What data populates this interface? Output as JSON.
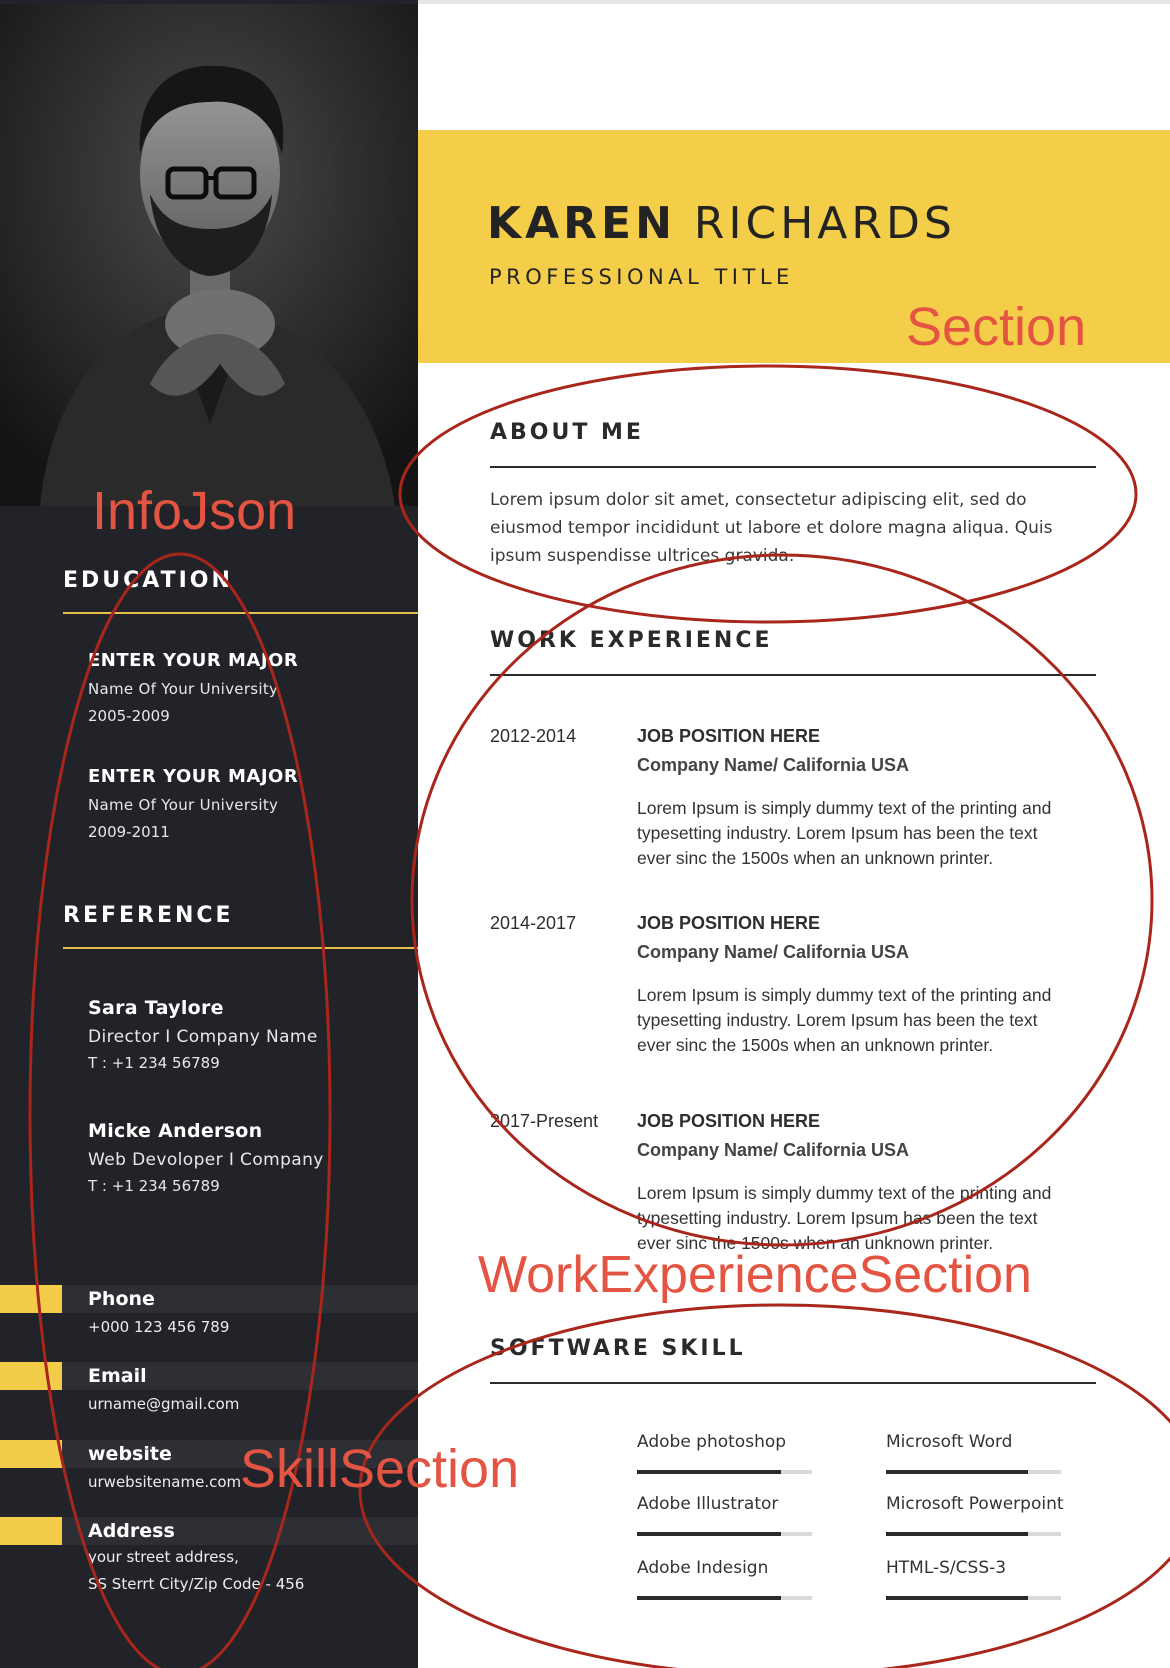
{
  "resume": {
    "first_name": "KAREN",
    "last_name": "RICHARDS",
    "professional_title": "PROFESSIONAL TITLE"
  },
  "sidebar": {
    "education": {
      "heading": "EDUCATION",
      "items": [
        {
          "major": "ENTER YOUR MAJOR",
          "university": "Name Of Your University",
          "years": "2005-2009"
        },
        {
          "major": "ENTER YOUR MAJOR",
          "university": "Name Of Your University",
          "years": "2009-2011"
        }
      ]
    },
    "reference": {
      "heading": "REFERENCE",
      "items": [
        {
          "name": "Sara Taylore",
          "role": "Director I Company Name",
          "tel": "T : +1 234 56789"
        },
        {
          "name": "Micke Anderson",
          "role": "Web Devoloper I Company",
          "tel": "T : +1 234 56789"
        }
      ]
    },
    "contact": [
      {
        "label": "Phone",
        "value": "+000 123 456 789",
        "value2": ""
      },
      {
        "label": "Email",
        "value": "urname@gmail.com",
        "value2": ""
      },
      {
        "label": "website",
        "value": "urwebsitename.com",
        "value2": ""
      },
      {
        "label": "Address",
        "value": "your street address,",
        "value2": "SS Sterrt City/Zip Code - 456"
      }
    ]
  },
  "about": {
    "heading": "ABOUT ME",
    "text": "Lorem ipsum dolor sit amet, consectetur adipiscing elit, sed do eiusmod tempor incididunt ut labore et dolore magna aliqua. Quis ipsum suspendisse ultrices gravida."
  },
  "work": {
    "heading": "WORK EXPERIENCE",
    "jobs": [
      {
        "years": "2012-2014",
        "position": "JOB POSITION HERE",
        "company": "Company Name/ California USA",
        "description": "Lorem Ipsum is simply dummy text of the printing and typesetting industry. Lorem Ipsum has been the text ever sinc the 1500s when an unknown printer."
      },
      {
        "years": "2014-2017",
        "position": "JOB POSITION HERE",
        "company": "Company Name/ California USA",
        "description": "Lorem Ipsum is simply dummy text of the printing and typesetting industry. Lorem Ipsum has been the text ever sinc the 1500s when an unknown printer."
      },
      {
        "years": "2017-Present",
        "position": "JOB POSITION HERE",
        "company": "Company Name/ California USA",
        "description": "Lorem Ipsum is simply dummy text of the printing and typesetting industry. Lorem Ipsum has been the text ever sinc the 1500s when an unknown printer."
      }
    ]
  },
  "skills": {
    "heading": "SOFTWARE SKILL",
    "items": [
      {
        "name": "Adobe photoshop",
        "level": 0.82
      },
      {
        "name": "Microsoft Word",
        "level": 0.81
      },
      {
        "name": "Adobe Illustrator",
        "level": 0.82
      },
      {
        "name": "Microsoft Powerpoint",
        "level": 0.81
      },
      {
        "name": "Adobe Indesign",
        "level": 0.82
      },
      {
        "name": "HTML-S/CSS-3",
        "level": 0.81
      }
    ]
  },
  "annotations": {
    "section": "Section",
    "info_json": "InfoJson",
    "work_experience_section": "WorkExperienceSection",
    "skill_section": "SkillSection"
  },
  "colors": {
    "accent_yellow": "#f4cd49",
    "sidebar_dark": "#222328",
    "annotation_red": "#e35442",
    "ellipse_red": "#a8261b"
  }
}
